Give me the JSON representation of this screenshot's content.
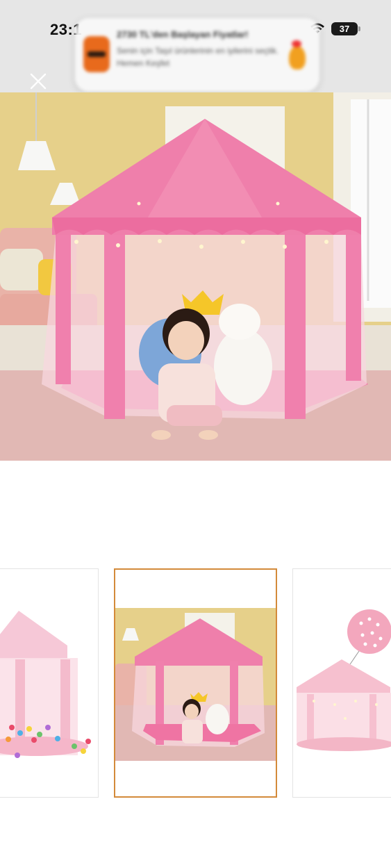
{
  "status_bar": {
    "time": "23:1",
    "battery_level": "37",
    "icons": [
      "wifi-icon",
      "battery-icon"
    ]
  },
  "notification": {
    "title": "2730 TL'den Başlayan Fiyatlar!",
    "body": "Senin için Taşıl ürünlerinin en iyilerini seçtik. Hemen Keşfet"
  },
  "gallery": {
    "close_icon": "close-icon",
    "thumbnail_count": 3,
    "selected_thumbnail": 2,
    "accent_color": "#d38a3a"
  }
}
